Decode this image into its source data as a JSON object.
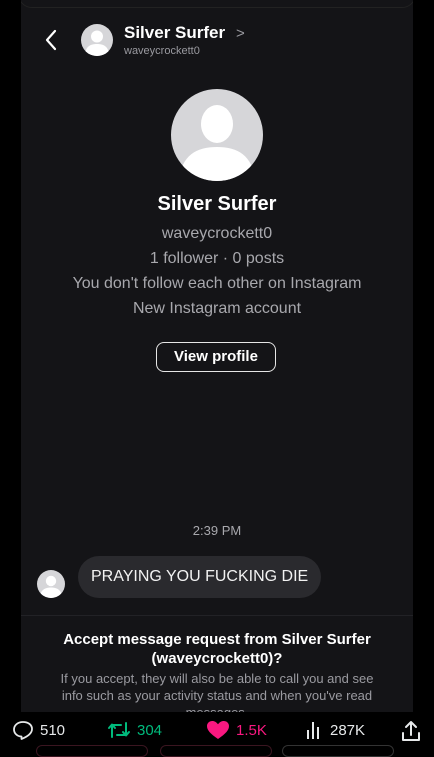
{
  "header": {
    "name": "Silver Surfer",
    "chevron": ">",
    "username": "waveycrockett0"
  },
  "profile": {
    "name": "Silver Surfer",
    "username": "waveycrockett0",
    "stats": "1 follower · 0 posts",
    "follow_status": "You don't follow each other on Instagram",
    "account_note": "New Instagram account",
    "view_profile_label": "View profile"
  },
  "conversation": {
    "timestamp": "2:39 PM",
    "message": "PRAYING YOU FUCKING DIE"
  },
  "request": {
    "title": "Accept message request from Silver Surfer (waveycrockett0)?",
    "body": "If you accept, they will also be able to call you and see info such as your activity status and when you've read messages."
  },
  "tweet_actions": {
    "replies": "510",
    "retweets": "304",
    "likes": "1.5K",
    "views": "287K"
  },
  "icons": {
    "back": "back-arrow-icon",
    "reply": "reply-bubble-icon",
    "retweet": "retweet-icon",
    "like": "heart-icon",
    "views": "bar-chart-icon",
    "share": "share-icon"
  },
  "colors": {
    "background": "#141417",
    "bubble": "#2a2a2e",
    "retweet": "#00ba7c",
    "like": "#f91880"
  }
}
